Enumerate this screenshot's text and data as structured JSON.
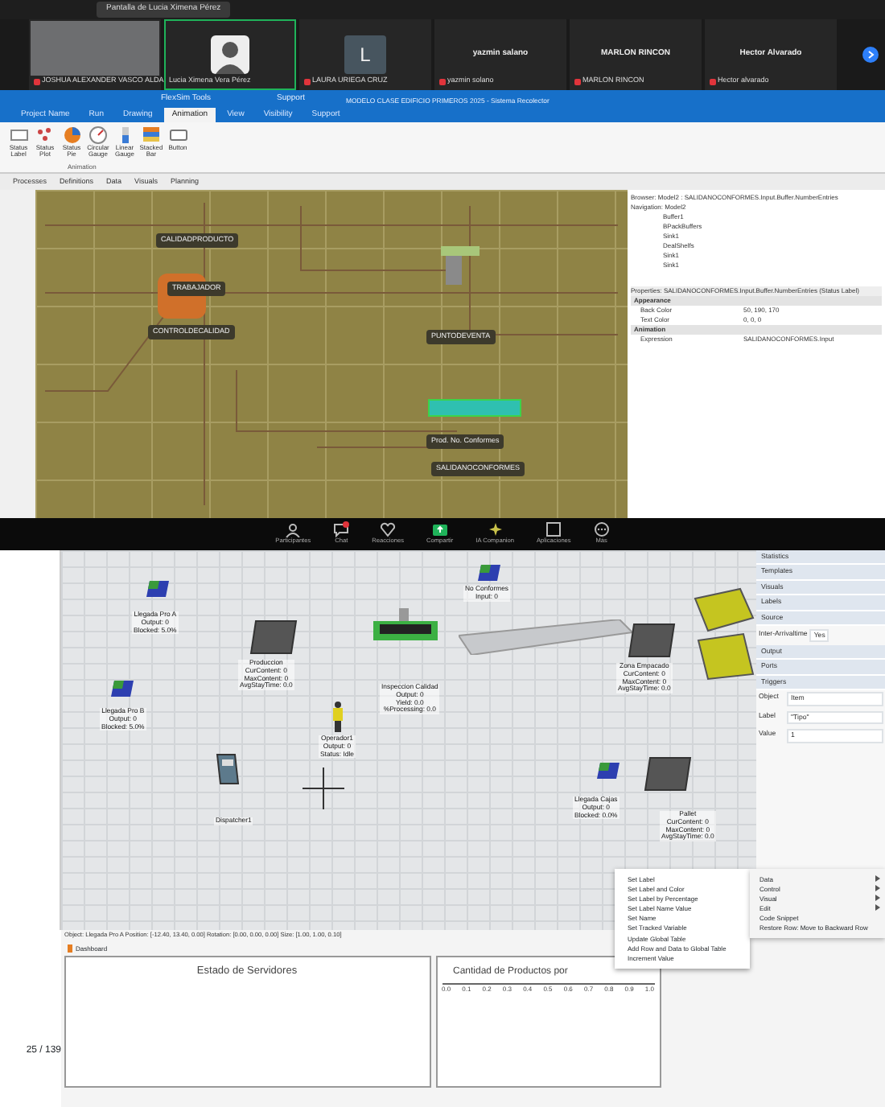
{
  "share_bar": {
    "title": "Pantalla de Lucia Ximena Pérez"
  },
  "participants": [
    {
      "kind": "video",
      "name": "JOSHUA ALEXANDER VASCO ALDA",
      "muted": true,
      "selected": false
    },
    {
      "kind": "avatar",
      "name": "Lucia Ximena Vera Pérez",
      "muted": false,
      "selected": true
    },
    {
      "kind": "initial",
      "initial": "L",
      "name": "LAURA URIEGA CRUZ",
      "muted": true,
      "selected": false
    },
    {
      "kind": "text",
      "display": "yazmin salano",
      "name": "yazmin solano",
      "muted": true,
      "selected": false
    },
    {
      "kind": "text",
      "display": "MARLON RINCON",
      "name": "MARLON RINCON",
      "muted": true,
      "selected": false
    },
    {
      "kind": "text",
      "display": "Hector Alvarado",
      "name": "Hector alvarado",
      "muted": true,
      "selected": false
    }
  ],
  "app": {
    "tools_title": "FlexSim Tools",
    "support": "Support",
    "window_title": "MODELO CLASE EDIFICIO PRIMEROS 2025 - Sistema Recolector",
    "tabs": [
      {
        "label": "Project Name",
        "selected": false
      },
      {
        "label": "Run",
        "selected": false
      },
      {
        "label": "Drawing",
        "selected": false
      },
      {
        "label": "Animation",
        "selected": true
      },
      {
        "label": "View",
        "selected": false
      },
      {
        "label": "Visibility",
        "selected": false
      },
      {
        "label": "Support",
        "selected": false
      }
    ],
    "ribbon_buttons": [
      {
        "kind": "label",
        "label": "Status\nLabel"
      },
      {
        "kind": "plot",
        "label": "Status\nPlot"
      },
      {
        "kind": "pie",
        "label": "Status\nPie"
      },
      {
        "kind": "gauge",
        "label": "Circular\nGauge"
      },
      {
        "kind": "linear",
        "label": "Linear\nGauge"
      },
      {
        "kind": "stacked",
        "label": "Stacked\nBar"
      },
      {
        "kind": "button",
        "label": "Button"
      }
    ],
    "ribbon_group": "Animation",
    "flow_tabs": [
      "Processes",
      "Definitions",
      "Data",
      "Visuals",
      "Planning"
    ],
    "canvas_labels": [
      "CALIDADPRODUCTO",
      "TRABAJADOR",
      "CONTROLDECALIDAD",
      "PUNTODEVENTA",
      "Prod. No. Conformes",
      "SALIDANOCONFORMES"
    ],
    "browser": {
      "title": "Browser: Model2 : SALIDANOCONFORMES.Input.Buffer.NumberEntries",
      "navigation": "Navigation: Model2",
      "items": [
        "Buffer1",
        "BPackBuffers",
        "Sink1",
        "DealShelfs",
        "Sink1",
        "Sink1"
      ]
    },
    "properties": {
      "title": "Properties: SALIDANOCONFORMES.Input.Buffer.NumberEntries (Status Label)",
      "sections": [
        {
          "name": "Appearance",
          "rows": [
            {
              "key": "Back Color",
              "value": "50, 190, 170"
            },
            {
              "key": "Text Color",
              "value": "0, 0, 0"
            }
          ]
        },
        {
          "name": "Animation",
          "rows": [
            {
              "key": "Expression",
              "value": "SALIDANOCONFORMES.Input"
            }
          ]
        }
      ]
    }
  },
  "zoom_toolbar": [
    {
      "kind": "people",
      "label": "Participantes"
    },
    {
      "kind": "chat",
      "label": "Chat"
    },
    {
      "kind": "heart",
      "label": "Reacciones"
    },
    {
      "kind": "share",
      "label": "Compartir"
    },
    {
      "kind": "spark",
      "label": "IA Companion"
    },
    {
      "kind": "apps",
      "label": "Aplicaciones"
    },
    {
      "kind": "more",
      "label": "Más"
    }
  ],
  "sim": {
    "objects": [
      {
        "kind": "source",
        "label": "Llegada Pro A\nOutput: 0\nBlocked: 5.0%"
      },
      {
        "kind": "source",
        "label": "Llegada Pro B\nOutput: 0\nBlocked: 5.0%"
      },
      {
        "kind": "queue",
        "label": "Produccion\nCurContent: 0\nMaxContent: 0\nAvgStayTime: 0.0"
      },
      {
        "kind": "processor",
        "label": "Inspeccion Calidad\nOutput: 0\nYield: 0.0\n%Processing: 0.0"
      },
      {
        "kind": "source",
        "label": "No Conformes\nInput: 0"
      },
      {
        "kind": "conveyor"
      },
      {
        "kind": "queue",
        "label": "Zona Empacado\nCurContent: 0\nMaxContent: 0\nAvgStayTime: 0.0"
      },
      {
        "kind": "operator",
        "label": "Operador1\nOutput: 0\nStatus: Idle"
      },
      {
        "kind": "dispatcher",
        "label": "Dispatcher1"
      },
      {
        "kind": "source",
        "label": "Llegada Cajas\nOutput: 0\nBlocked: 0.0%"
      },
      {
        "kind": "queue",
        "label": "Pallet\nCurContent: 0\nMaxContent: 0\nAvgStayTime: 0.0"
      }
    ],
    "status_line": "Object: Llegada Pro A Position: [-12.40, 13.40, 0.00] Rotation: [0.00, 0.00, 0.00] Size: [1.00, 1.00, 0.10]",
    "dashboard_tab": "Dashboard",
    "left_count": "25 / 139",
    "panels": [
      {
        "title": "Estado de Servidores"
      },
      {
        "title": "Cantidad de Productos por",
        "ticks": [
          "0.0",
          "0.1",
          "0.2",
          "0.3",
          "0.4",
          "0.5",
          "0.6",
          "0.7",
          "0.8",
          "0.9",
          "1.0"
        ]
      }
    ],
    "context_menu": [
      "Set Label",
      "Set Label and Color",
      "Set Label by Percentage",
      "Set Label Name Value",
      "Set Name",
      "Set Tracked Variable",
      "Update Global Table",
      "Add Row and Data to Global Table",
      "Increment Value"
    ],
    "submenu": [
      {
        "label": "Data",
        "arrow": true
      },
      {
        "label": "Control",
        "arrow": true
      },
      {
        "label": "Visual",
        "arrow": true
      },
      {
        "label": "Edit",
        "arrow": true
      },
      {
        "label": "Code Snippet",
        "arrow": false
      },
      {
        "label": "Restore Row: Move to Backward Row",
        "arrow": false
      }
    ],
    "right_sections": [
      "Statistics",
      "Templates",
      "Visuals",
      "Labels",
      "Source",
      "Output",
      "Ports",
      "Triggers"
    ],
    "right_fields": [
      {
        "key": "Inter-Arrivaltime",
        "value": "Yes"
      },
      {
        "key": "Object",
        "value": "Item"
      },
      {
        "key": "Label",
        "value": "\"Tipo\""
      },
      {
        "key": "Value",
        "value": "1"
      }
    ]
  }
}
